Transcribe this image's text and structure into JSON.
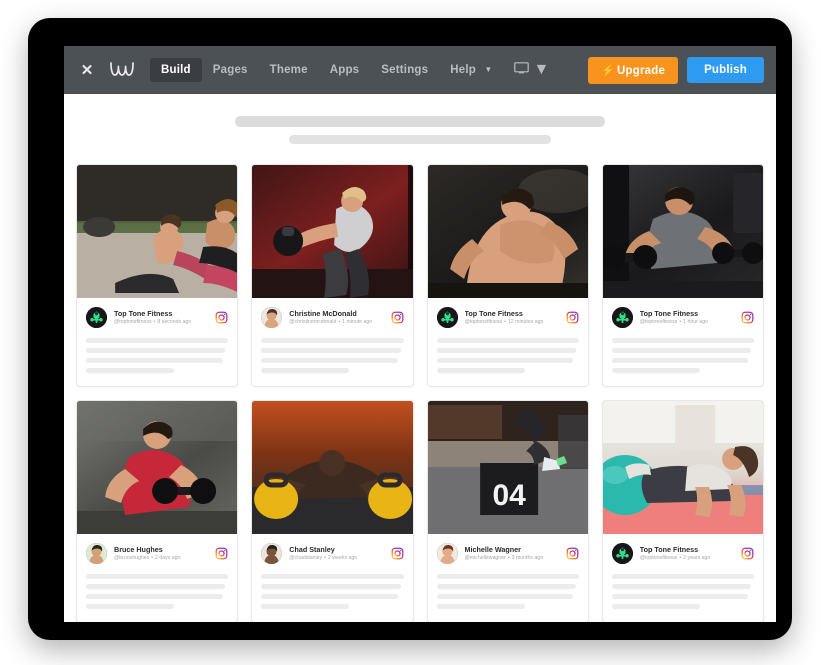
{
  "toolbar": {
    "close_label": "✕",
    "logo_name": "weebly-logo",
    "nav": [
      {
        "label": "Build",
        "active": true,
        "has_chevron": false
      },
      {
        "label": "Pages",
        "active": false,
        "has_chevron": false
      },
      {
        "label": "Theme",
        "active": false,
        "has_chevron": false
      },
      {
        "label": "Apps",
        "active": false,
        "has_chevron": false
      },
      {
        "label": "Settings",
        "active": false,
        "has_chevron": false
      },
      {
        "label": "Help",
        "active": false,
        "has_chevron": true
      }
    ],
    "device_chevron": "⌄",
    "upgrade_label": "Upgrade",
    "upgrade_bolt": "⚡",
    "publish_label": "Publish",
    "colors": {
      "toolbar_bg": "#4c5156",
      "active_pill": "#3a3e43",
      "upgrade": "#f7931e",
      "publish": "#2e9bf0"
    }
  },
  "hero": {
    "title_placeholder": "",
    "subtitle_placeholder": ""
  },
  "feed": {
    "posts": [
      {
        "username": "Top Tone Fitness",
        "handle": "@toptonefitness",
        "separator": "•",
        "timestamp": "8 seconds ago",
        "network_icon": "instagram-icon",
        "avatar_type": "logo",
        "image_alt": "two women stretching on yoga mats in a studio"
      },
      {
        "username": "Christine McDonald",
        "handle": "@christinemcdonald",
        "separator": "•",
        "timestamp": "1 minute ago",
        "network_icon": "instagram-icon",
        "avatar_type": "photo",
        "image_alt": "woman doing kettlebell swing in a red-lit gym"
      },
      {
        "username": "Top Tone Fitness",
        "handle": "@toptonefitness",
        "separator": "•",
        "timestamp": "12 minutes ago",
        "network_icon": "instagram-icon",
        "avatar_type": "logo",
        "image_alt": "muscular man flexing back in dark gym"
      },
      {
        "username": "Top Tone Fitness",
        "handle": "@toptonefitness",
        "separator": "•",
        "timestamp": "1 hour ago",
        "network_icon": "instagram-icon",
        "avatar_type": "logo",
        "image_alt": "man lifting dumbbells on a bench"
      },
      {
        "username": "Bruce Hughes",
        "handle": "@brucehughes",
        "separator": "•",
        "timestamp": "2 days ago",
        "network_icon": "instagram-icon",
        "avatar_type": "photo",
        "image_alt": "man in red tank top curling a dumbbell"
      },
      {
        "username": "Chad Stanley",
        "handle": "@chadstanley",
        "separator": "•",
        "timestamp": "2 weeks ago",
        "network_icon": "instagram-icon",
        "avatar_type": "photo",
        "image_alt": "man doing push-ups between two kettlebells"
      },
      {
        "username": "Michelle Wagner",
        "handle": "@michellewagner",
        "separator": "•",
        "timestamp": "3 months ago",
        "network_icon": "instagram-icon",
        "avatar_type": "photo",
        "image_overlay_text": "04",
        "image_alt": "person box-jumping onto a plyo box numbered 04"
      },
      {
        "username": "Top Tone Fitness",
        "handle": "@toptonefitness",
        "separator": "•",
        "timestamp": "2 years ago",
        "network_icon": "instagram-icon",
        "avatar_type": "logo",
        "image_alt": "woman planking on a teal exercise ball"
      }
    ]
  }
}
